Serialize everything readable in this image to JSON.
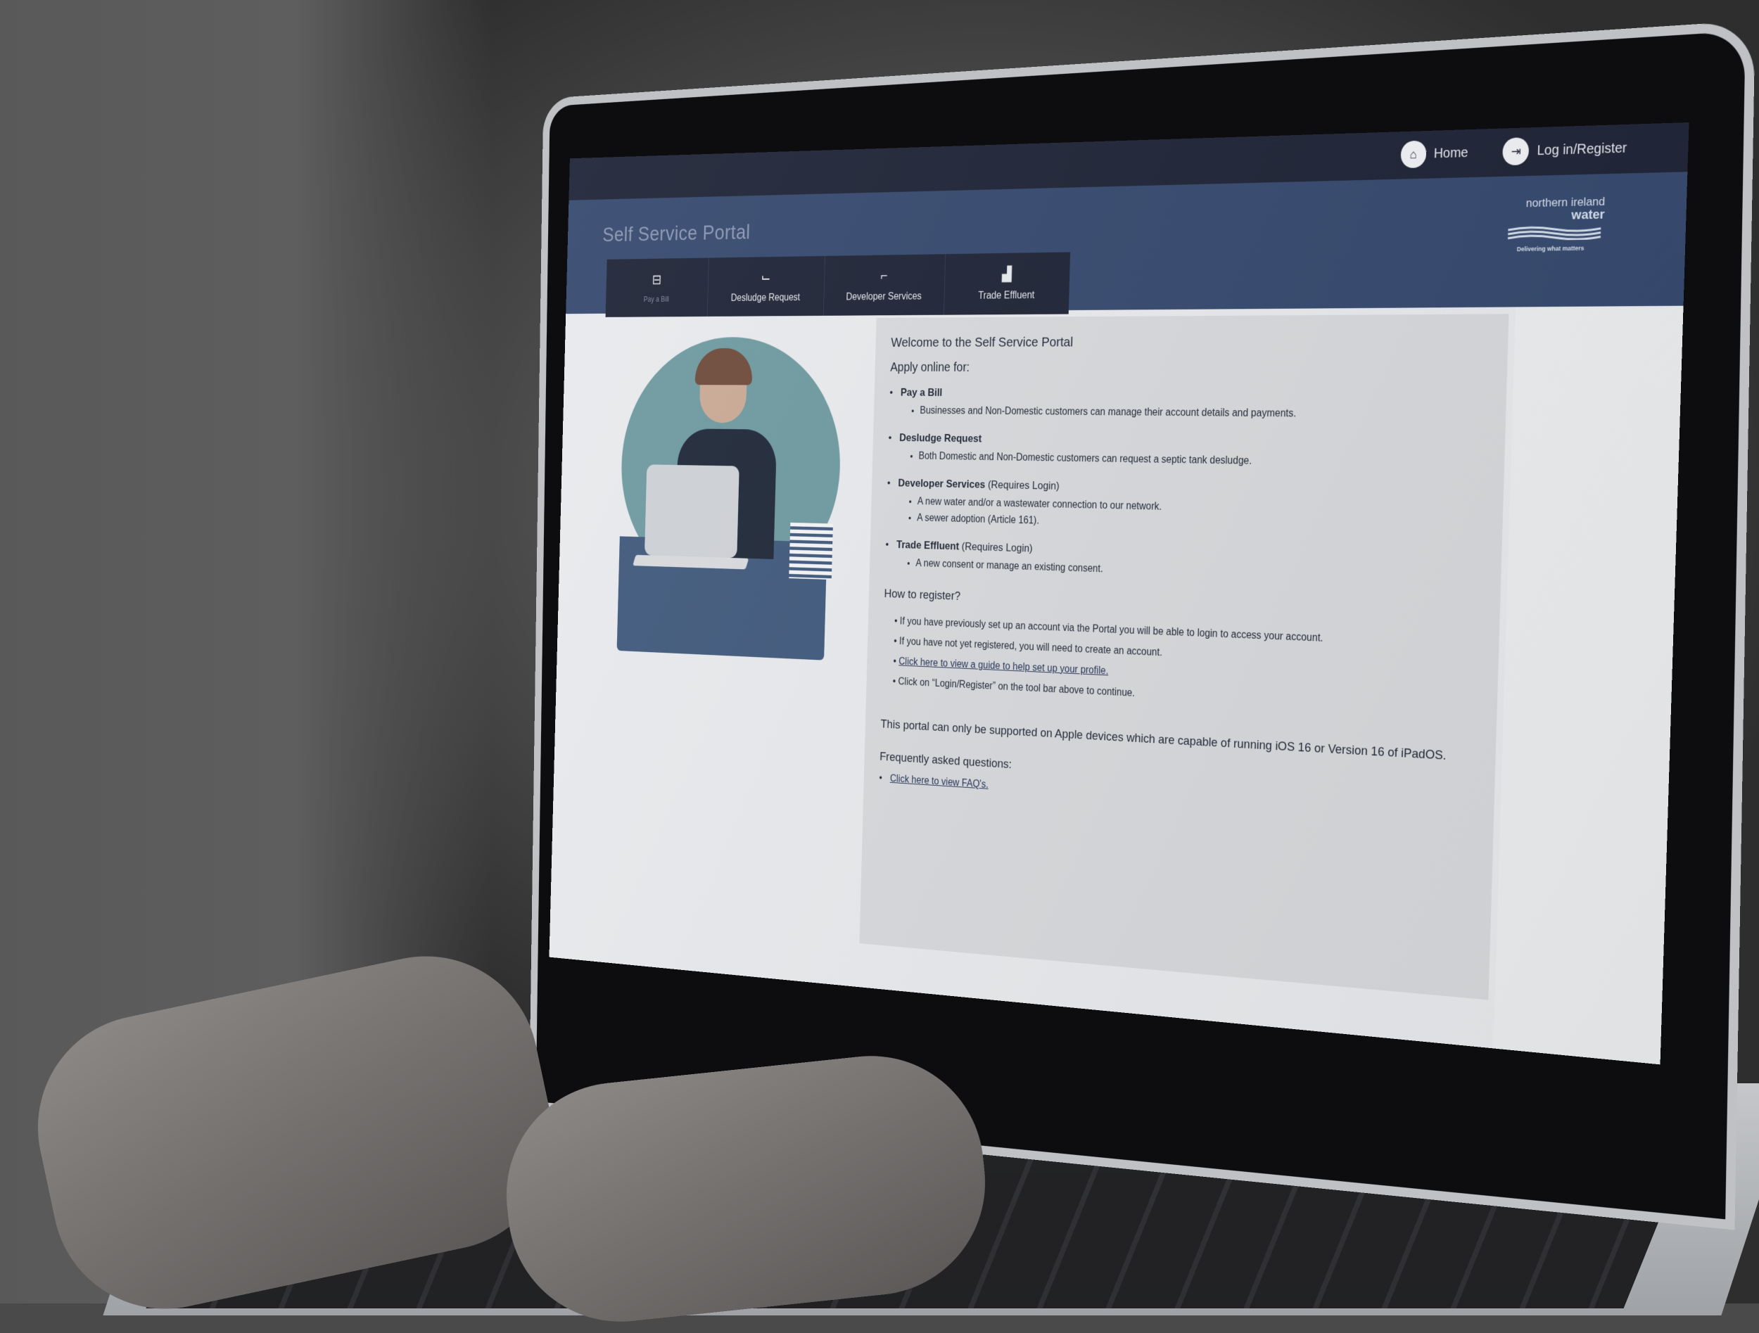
{
  "topbar": {
    "crumb": "",
    "home_label": "Home",
    "login_label": "Log in/Register",
    "home_icon": "home-icon",
    "login_icon": "login-icon"
  },
  "header": {
    "title": "Self Service Portal",
    "logo": {
      "line1": "northern ireland",
      "line2": "water",
      "tagline": "Delivering what matters"
    }
  },
  "tabs": [
    {
      "label": "Pay a Bill",
      "icon": "bill-icon"
    },
    {
      "label": "Desludge Request",
      "icon": "pipe-icon"
    },
    {
      "label": "Developer Services",
      "icon": "tap-icon"
    },
    {
      "label": "Trade Effluent",
      "icon": "factory-icon"
    }
  ],
  "welcome": {
    "title": "Welcome to the Self Service Portal",
    "apply_label": "Apply online for:",
    "services": [
      {
        "name": "Pay a Bill",
        "note": "",
        "items": [
          "Businesses and Non-Domestic customers can manage their account details and payments."
        ]
      },
      {
        "name": "Desludge Request",
        "note": "",
        "items": [
          "Both Domestic and Non-Domestic customers can request a septic tank desludge."
        ]
      },
      {
        "name": "Developer Services",
        "note": "(Requires Login)",
        "items": [
          "A new water and/or a wastewater connection to our network.",
          "A sewer adoption (Article 161)."
        ]
      },
      {
        "name": "Trade Effluent",
        "note": "(Requires Login)",
        "items": [
          "A new consent or manage an existing consent."
        ]
      }
    ],
    "how_title": "How to register?",
    "register": [
      "If you have previously set up an account via the Portal you will be able to login to access your account.",
      "If you have not yet registered, you will need to create an account.",
      "Click here to view a guide to help set up your profile.",
      "Click on “Login/Register” on the tool bar above to continue."
    ],
    "support": "This portal can only be supported on Apple devices which are capable of running iOS 16 or Version 16 of iPadOS.",
    "faq_title": "Frequently asked questions:",
    "faq_link": "Click here to view FAQ's."
  },
  "colors": {
    "topbar": "#1e2436",
    "header": "#35496e",
    "tab_bg": "#1e2436",
    "card": "#d7d9dc",
    "link": "#1e2c52"
  }
}
